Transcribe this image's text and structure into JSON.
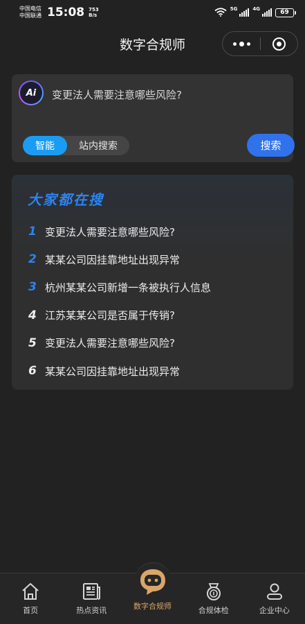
{
  "status_bar": {
    "carrier_1": "中国电信",
    "carrier_2": "中国联通",
    "time": "15:08",
    "net_speed_value": "753",
    "net_speed_unit": "B/s",
    "sig1_label": "5G",
    "sig2_label": "4G",
    "battery": "69"
  },
  "nav": {
    "title": "数字合规师"
  },
  "search": {
    "query": "变更法人需要注意哪些风险?",
    "mode_smart": "智能",
    "mode_site": "站内搜索",
    "button": "搜索"
  },
  "hot": {
    "title": "大家都在搜",
    "items": [
      {
        "rank": "1",
        "text": "变更法人需要注意哪些风险?"
      },
      {
        "rank": "2",
        "text": "某某公司因挂靠地址出现异常"
      },
      {
        "rank": "3",
        "text": "杭州某某公司新增一条被执行人信息"
      },
      {
        "rank": "4",
        "text": "江苏某某公司是否属于传销?"
      },
      {
        "rank": "5",
        "text": "变更法人需要注意哪些风险?"
      },
      {
        "rank": "6",
        "text": "某某公司因挂靠地址出现异常"
      }
    ]
  },
  "tabs": [
    {
      "label": "首页",
      "icon": "home-icon"
    },
    {
      "label": "热点资讯",
      "icon": "news-icon"
    },
    {
      "label": "数字合规师",
      "icon": "robot-icon"
    },
    {
      "label": "合规体检",
      "icon": "medal-icon"
    },
    {
      "label": "企业中心",
      "icon": "user-icon"
    }
  ],
  "colors": {
    "accent_blue": "#2c84f2",
    "toggle_blue": "#1a9cf2",
    "button_blue": "#2f72ec",
    "active_tab": "#d9a66a",
    "background": "#222222"
  }
}
